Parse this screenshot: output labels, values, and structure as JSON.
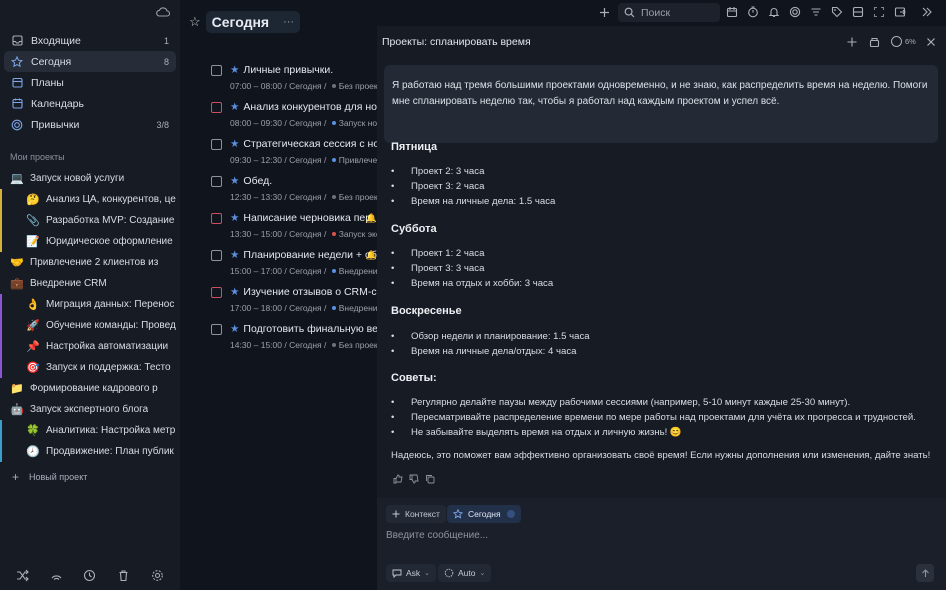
{
  "sidebar": {
    "nav": [
      {
        "label": "Входящие",
        "count": "1",
        "icon": "inbox-icon"
      },
      {
        "label": "Сегодня",
        "count": "8",
        "icon": "star-icon"
      },
      {
        "label": "Планы",
        "count": "",
        "icon": "plans-icon"
      },
      {
        "label": "Календарь",
        "count": "",
        "icon": "calendar-icon"
      },
      {
        "label": "Привычки",
        "count": "3/8",
        "icon": "habits-icon"
      }
    ],
    "section_title": "Мои проекты",
    "projects": [
      {
        "emoji": "💻",
        "label": "Запуск новой услуги",
        "level": 0,
        "bar": ""
      },
      {
        "emoji": "🤔",
        "label": "Анализ ЦА, конкурентов, це",
        "level": 1,
        "bar": "#d4b13a"
      },
      {
        "emoji": "📎",
        "label": "Разработка MVP: Создание",
        "level": 1,
        "bar": "#d4b13a"
      },
      {
        "emoji": "📝",
        "label": "Юридическое оформление",
        "level": 1,
        "bar": "#d4b13a"
      },
      {
        "emoji": "🤝",
        "label": "Привлечение 2 клиентов из",
        "level": 0,
        "bar": ""
      },
      {
        "emoji": "💼",
        "label": "Внедрение CRM",
        "level": 0,
        "bar": ""
      },
      {
        "emoji": "👌",
        "label": "Миграция данных: Перенос",
        "level": 1,
        "bar": "#8a55d6"
      },
      {
        "emoji": "🚀",
        "label": "Обучение команды: Провед",
        "level": 1,
        "bar": "#8a55d6"
      },
      {
        "emoji": "📌",
        "label": "Настройка автоматизации",
        "level": 1,
        "bar": "#8a55d6"
      },
      {
        "emoji": "🎯",
        "label": "Запуск и поддержка: Тесто",
        "level": 1,
        "bar": "#8a55d6"
      },
      {
        "emoji": "📁",
        "label": "Формирование кадрового р",
        "level": 0,
        "bar": ""
      },
      {
        "emoji": "🤖",
        "label": "Запуск экспертного блога",
        "level": 0,
        "bar": ""
      },
      {
        "emoji": "🍀",
        "label": "Аналитика: Настройка метр",
        "level": 1,
        "bar": "#3aa0c9"
      },
      {
        "emoji": "🕗",
        "label": "Продвижение: План публик",
        "level": 1,
        "bar": "#3aa0c9"
      }
    ],
    "new_project": "Новый проект"
  },
  "tasks_panel": {
    "title": "Сегодня",
    "more": "···",
    "tasks": [
      {
        "title": "Личные привычки.",
        "meta_time": "07:00 – 08:00 / Сегодня",
        "meta_proj": "Без проект",
        "dot": "#6b7280",
        "red": false,
        "bell": false
      },
      {
        "title": "Анализ конкурентов для нового",
        "meta_time": "08:00 – 09:30 / Сегодня",
        "meta_proj": "Запуск нов",
        "dot": "#5b8fe0",
        "red": true,
        "bell": false
      },
      {
        "title": "Стратегическая сессия с новой",
        "meta_time": "09:30 – 12:30 / Сегодня",
        "meta_proj": "Привлече",
        "dot": "#5b8fe0",
        "red": false,
        "bell": false
      },
      {
        "title": "Обед.",
        "meta_time": "12:30 – 13:30 / Сегодня",
        "meta_proj": "Без проект",
        "dot": "#6b7280",
        "red": false,
        "bell": false
      },
      {
        "title": "Написание черновика пер",
        "meta_time": "13:30 – 15:00 / Сегодня",
        "meta_proj": "Запуск экс",
        "dot": "#d9534f",
        "red": true,
        "bell": true
      },
      {
        "title": "Планирование недели + обе",
        "meta_time": "15:00 – 17:00 / Сегодня",
        "meta_proj": "Внедрени",
        "dot": "#5b8fe0",
        "red": false,
        "bell": true
      },
      {
        "title": "Изучение отзывов о CRM-сис",
        "meta_time": "17:00 – 18:00 / Сегодня",
        "meta_proj": "Внедрени",
        "dot": "#5b8fe0",
        "red": true,
        "bell": false
      },
      {
        "title": "Подготовить финальную верс",
        "meta_time": "14:30 – 15:00 / Сегодня",
        "meta_proj": "Без проект",
        "dot": "#6b7280",
        "red": false,
        "bell": false
      }
    ]
  },
  "topbar": {
    "search_placeholder": "Поиск"
  },
  "chat": {
    "title": "Проекты: спланировать время",
    "context_percent": "6%",
    "user_message": "Я работаю над тремя большими проектами одновременно, и не знаю, как распределить время на неделю. Помоги мне спланировать неделю так, чтобы я работал над каждым проектом и успел всё.",
    "sections": [
      {
        "heading": "Пятница",
        "items": [
          "Проект 2: 3 часа",
          "Проект 3: 2 часа",
          "Время на личные дела: 1.5 часа"
        ]
      },
      {
        "heading": "Суббота",
        "items": [
          "Проект 1: 2 часа",
          "Проект 3: 3 часа",
          "Время на отдых и хобби: 3 часа"
        ]
      },
      {
        "heading": "Воскресенье",
        "items": [
          "Обзор недели и планирование: 1.5 часа",
          "Время на личные дела/отдых: 4 часа"
        ]
      },
      {
        "heading": "Советы:",
        "items": [
          "Регулярно делайте паузы между рабочими сессиями (например, 5-10 минут каждые 25-30 минут).",
          "Пересматривайте распределение времени по мере работы над проектами для учёта их прогресса и трудностей.",
          "Не забывайте выделять время на отдых и личную жизнь! 😊"
        ]
      }
    ],
    "closing": "Надеюсь, это поможет вам эффективно организовать своё время! Если нужны дополнения или изменения, дайте знать!",
    "composer": {
      "context_chip": "Контекст",
      "today_chip": "Сегодня",
      "placeholder": "Введите сообщение...",
      "mode": "Ask",
      "model": "Auto"
    }
  }
}
